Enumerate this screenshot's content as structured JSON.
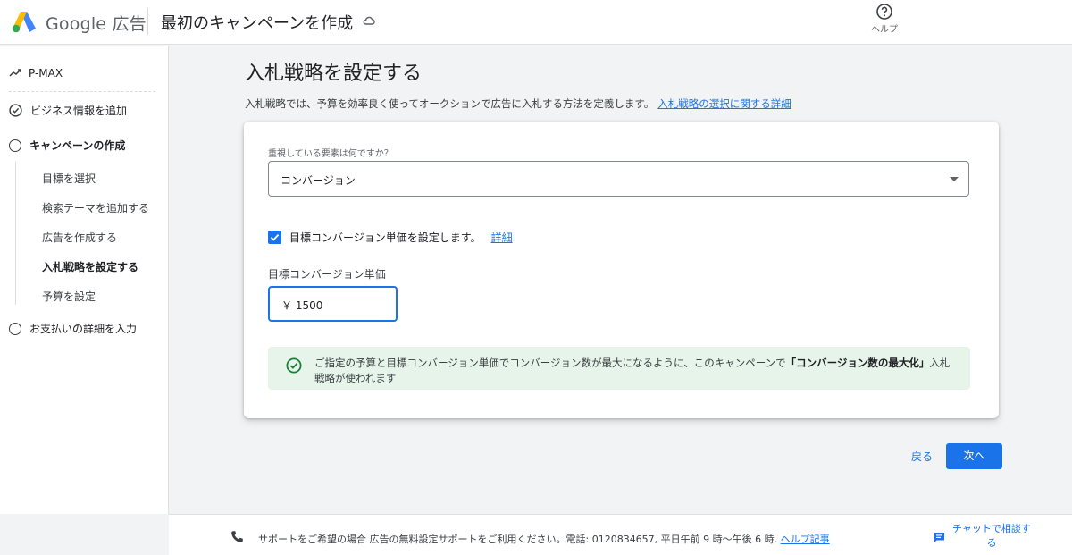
{
  "header": {
    "brand": "Google 広告",
    "campaign_title": "最初のキャンペーンを作成",
    "help_label": "ヘルプ"
  },
  "sidebar": {
    "pmax_label": "P-MAX",
    "steps": [
      {
        "label": "ビジネス情報を追加",
        "state": "done"
      },
      {
        "label": "キャンペーンの作成",
        "state": "current"
      },
      {
        "label": "お支払いの詳細を入力",
        "state": "pending"
      }
    ],
    "substeps": [
      {
        "label": "目標を選択"
      },
      {
        "label": "検索テーマを追加する"
      },
      {
        "label": "広告を作成する"
      },
      {
        "label": "入札戦略を設定する",
        "active": true
      },
      {
        "label": "予算を設定"
      }
    ]
  },
  "main": {
    "title": "入札戦略を設定する",
    "description": "入札戦略では、予算を効率良く使ってオークションで広告に入札する方法を定義します。",
    "description_link": "入札戦略の選択に関する詳細",
    "card": {
      "select_label": "重視している要素は何ですか？",
      "select_value": "コンバージョン",
      "checkbox_label": "目標コンバージョン単価を設定します。",
      "checkbox_checked": true,
      "checkbox_link": "詳細",
      "field_label": "目標コンバージョン単価",
      "field_value": "￥ 1500",
      "notice_text_pre": "ご指定の予算と目標コンバージョン単価でコンバージョン数が最大になるように、このキャンペーンで",
      "notice_text_bold": "「コンバージョン数の最大化」",
      "notice_text_post": "入札戦略が使われます"
    },
    "back_label": "戻る",
    "next_label": "次へ"
  },
  "footer": {
    "support_text": "サポートをご希望の場合 広告の無料設定サポートをご利用ください。電話: 0120834657, 平日午前 9 時〜午後 6 時.",
    "support_link": "ヘルプ記事",
    "chat_label": "チャットで相談する"
  },
  "colors": {
    "accent": "#1a73e8",
    "success": "#188038",
    "notice_bg": "#e6f4ea"
  },
  "icons": [
    "google-ads-logo-icon",
    "cloud-sync-icon",
    "help-icon",
    "trend-icon",
    "check-circle-icon",
    "circle-icon",
    "dropdown-caret-icon",
    "checkbox-check-icon",
    "phone-icon",
    "chat-icon"
  ]
}
